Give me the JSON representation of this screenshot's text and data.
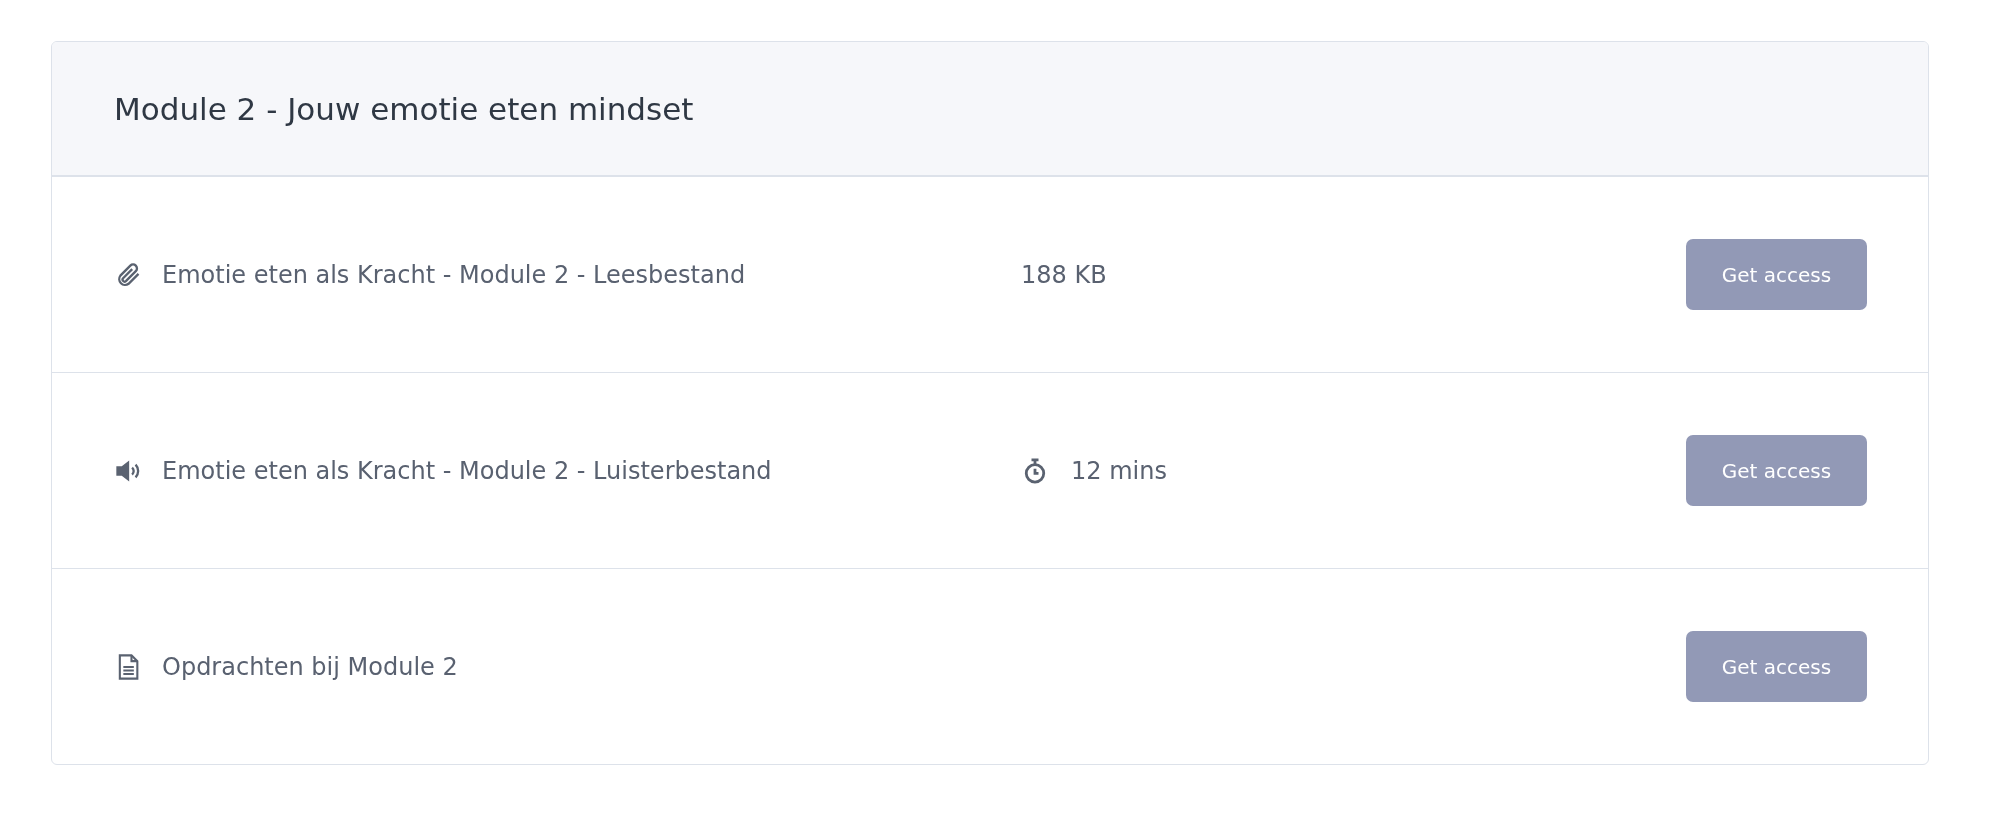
{
  "module": {
    "title": "Module 2 - Jouw emotie eten mindset",
    "items": [
      {
        "kind": "attachment",
        "title": "Emotie eten als Kracht - Module 2 - Leesbestand",
        "meta": {
          "kind": "size",
          "text": "188 KB"
        },
        "button": {
          "label": "Get access",
          "disabled": true
        }
      },
      {
        "kind": "audio",
        "title": "Emotie eten als Kracht - Module 2 - Luisterbestand",
        "meta": {
          "kind": "duration",
          "text": "12 mins"
        },
        "button": {
          "label": "Get access",
          "disabled": true
        }
      },
      {
        "kind": "document",
        "title": "Opdrachten bij Module 2",
        "button": {
          "label": "Get access",
          "disabled": true
        }
      }
    ]
  }
}
